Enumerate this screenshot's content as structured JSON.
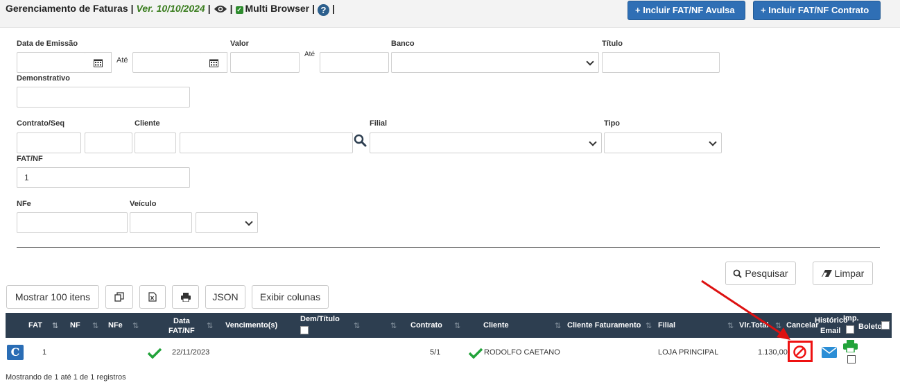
{
  "header": {
    "title": "Gerenciamento de Faturas",
    "version": "Ver. 10/10/2024",
    "multi_browser": "Multi Browser",
    "help": "?",
    "btn_avulsa": "Incluir FAT/NF Avulsa",
    "btn_contrato": "Incluir FAT/NF Contrato",
    "plus": "+"
  },
  "filters": {
    "data_emissao": "Data de Emissão",
    "ate1": "Até",
    "valor": "Valor",
    "ate2": "Até",
    "banco": "Banco",
    "titulo": "Título",
    "demonstrativo": "Demonstrativo",
    "contrato_seq": "Contrato/Seq",
    "cliente": "Cliente",
    "filial": "Filial",
    "tipo": "Tipo",
    "fat_nf": "FAT/NF",
    "fat_nf_value": "1",
    "nfe": "NFe",
    "veiculo": "Veículo"
  },
  "actions": {
    "pesquisar": "Pesquisar",
    "limpar": "Limpar"
  },
  "toolbar": {
    "mostrar": "Mostrar 100 itens",
    "json": "JSON",
    "exibir_colunas": "Exibir colunas"
  },
  "table": {
    "headers": {
      "fat": "FAT",
      "nf": "NF",
      "nfe": "NFe",
      "data_l1": "Data",
      "data_l2": "FAT/NF",
      "vencimento": "Vencimento(s)",
      "dem_titulo": "Dem/Título",
      "contrato": "Contrato",
      "cliente": "Cliente",
      "cliente_fat": "Cliente Faturamento",
      "filial": "Filial",
      "vlr_total": "Vlr.Total",
      "cancelar": "Cancelar",
      "hist_l1": "Histórico",
      "hist_l2": "Email",
      "imp": "Imp.",
      "boleto": "Boleto"
    },
    "row": {
      "badge": "C",
      "fat": "1",
      "data": "22/11/2023",
      "contrato": "5/1",
      "cliente": "RODOLFO CAETANO",
      "filial": "LOJA PRINCIPAL",
      "vlr_total": "1.130,00"
    },
    "footer": "Mostrando de 1 até 1 de 1 registros"
  },
  "colors": {
    "primary": "#2f6fb5",
    "table_header": "#2d3e50",
    "success": "#22a33a",
    "danger": "#e11111"
  }
}
